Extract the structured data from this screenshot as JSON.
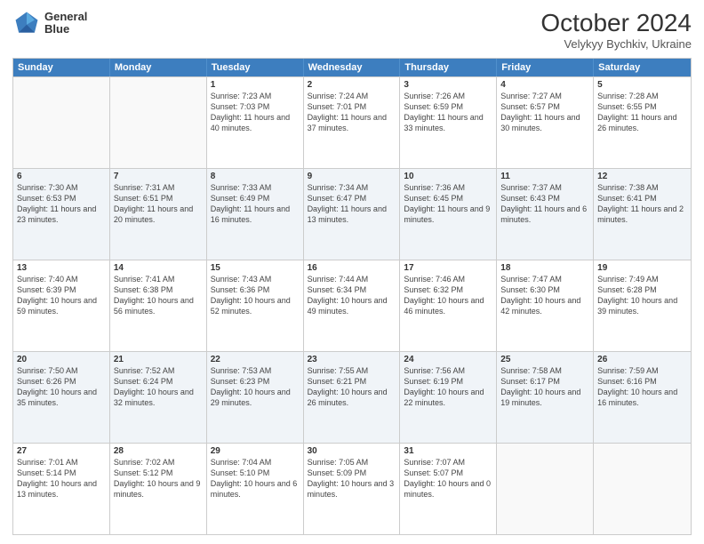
{
  "header": {
    "logo": {
      "line1": "General",
      "line2": "Blue"
    },
    "title": "October 2024",
    "location": "Velykyy Bychkiv, Ukraine"
  },
  "days_of_week": [
    "Sunday",
    "Monday",
    "Tuesday",
    "Wednesday",
    "Thursday",
    "Friday",
    "Saturday"
  ],
  "weeks": [
    [
      {
        "day": "",
        "sunrise": "",
        "sunset": "",
        "daylight": "",
        "empty": true
      },
      {
        "day": "",
        "sunrise": "",
        "sunset": "",
        "daylight": "",
        "empty": true
      },
      {
        "day": "1",
        "sunrise": "Sunrise: 7:23 AM",
        "sunset": "Sunset: 7:03 PM",
        "daylight": "Daylight: 11 hours and 40 minutes.",
        "empty": false
      },
      {
        "day": "2",
        "sunrise": "Sunrise: 7:24 AM",
        "sunset": "Sunset: 7:01 PM",
        "daylight": "Daylight: 11 hours and 37 minutes.",
        "empty": false
      },
      {
        "day": "3",
        "sunrise": "Sunrise: 7:26 AM",
        "sunset": "Sunset: 6:59 PM",
        "daylight": "Daylight: 11 hours and 33 minutes.",
        "empty": false
      },
      {
        "day": "4",
        "sunrise": "Sunrise: 7:27 AM",
        "sunset": "Sunset: 6:57 PM",
        "daylight": "Daylight: 11 hours and 30 minutes.",
        "empty": false
      },
      {
        "day": "5",
        "sunrise": "Sunrise: 7:28 AM",
        "sunset": "Sunset: 6:55 PM",
        "daylight": "Daylight: 11 hours and 26 minutes.",
        "empty": false
      }
    ],
    [
      {
        "day": "6",
        "sunrise": "Sunrise: 7:30 AM",
        "sunset": "Sunset: 6:53 PM",
        "daylight": "Daylight: 11 hours and 23 minutes.",
        "empty": false
      },
      {
        "day": "7",
        "sunrise": "Sunrise: 7:31 AM",
        "sunset": "Sunset: 6:51 PM",
        "daylight": "Daylight: 11 hours and 20 minutes.",
        "empty": false
      },
      {
        "day": "8",
        "sunrise": "Sunrise: 7:33 AM",
        "sunset": "Sunset: 6:49 PM",
        "daylight": "Daylight: 11 hours and 16 minutes.",
        "empty": false
      },
      {
        "day": "9",
        "sunrise": "Sunrise: 7:34 AM",
        "sunset": "Sunset: 6:47 PM",
        "daylight": "Daylight: 11 hours and 13 minutes.",
        "empty": false
      },
      {
        "day": "10",
        "sunrise": "Sunrise: 7:36 AM",
        "sunset": "Sunset: 6:45 PM",
        "daylight": "Daylight: 11 hours and 9 minutes.",
        "empty": false
      },
      {
        "day": "11",
        "sunrise": "Sunrise: 7:37 AM",
        "sunset": "Sunset: 6:43 PM",
        "daylight": "Daylight: 11 hours and 6 minutes.",
        "empty": false
      },
      {
        "day": "12",
        "sunrise": "Sunrise: 7:38 AM",
        "sunset": "Sunset: 6:41 PM",
        "daylight": "Daylight: 11 hours and 2 minutes.",
        "empty": false
      }
    ],
    [
      {
        "day": "13",
        "sunrise": "Sunrise: 7:40 AM",
        "sunset": "Sunset: 6:39 PM",
        "daylight": "Daylight: 10 hours and 59 minutes.",
        "empty": false
      },
      {
        "day": "14",
        "sunrise": "Sunrise: 7:41 AM",
        "sunset": "Sunset: 6:38 PM",
        "daylight": "Daylight: 10 hours and 56 minutes.",
        "empty": false
      },
      {
        "day": "15",
        "sunrise": "Sunrise: 7:43 AM",
        "sunset": "Sunset: 6:36 PM",
        "daylight": "Daylight: 10 hours and 52 minutes.",
        "empty": false
      },
      {
        "day": "16",
        "sunrise": "Sunrise: 7:44 AM",
        "sunset": "Sunset: 6:34 PM",
        "daylight": "Daylight: 10 hours and 49 minutes.",
        "empty": false
      },
      {
        "day": "17",
        "sunrise": "Sunrise: 7:46 AM",
        "sunset": "Sunset: 6:32 PM",
        "daylight": "Daylight: 10 hours and 46 minutes.",
        "empty": false
      },
      {
        "day": "18",
        "sunrise": "Sunrise: 7:47 AM",
        "sunset": "Sunset: 6:30 PM",
        "daylight": "Daylight: 10 hours and 42 minutes.",
        "empty": false
      },
      {
        "day": "19",
        "sunrise": "Sunrise: 7:49 AM",
        "sunset": "Sunset: 6:28 PM",
        "daylight": "Daylight: 10 hours and 39 minutes.",
        "empty": false
      }
    ],
    [
      {
        "day": "20",
        "sunrise": "Sunrise: 7:50 AM",
        "sunset": "Sunset: 6:26 PM",
        "daylight": "Daylight: 10 hours and 35 minutes.",
        "empty": false
      },
      {
        "day": "21",
        "sunrise": "Sunrise: 7:52 AM",
        "sunset": "Sunset: 6:24 PM",
        "daylight": "Daylight: 10 hours and 32 minutes.",
        "empty": false
      },
      {
        "day": "22",
        "sunrise": "Sunrise: 7:53 AM",
        "sunset": "Sunset: 6:23 PM",
        "daylight": "Daylight: 10 hours and 29 minutes.",
        "empty": false
      },
      {
        "day": "23",
        "sunrise": "Sunrise: 7:55 AM",
        "sunset": "Sunset: 6:21 PM",
        "daylight": "Daylight: 10 hours and 26 minutes.",
        "empty": false
      },
      {
        "day": "24",
        "sunrise": "Sunrise: 7:56 AM",
        "sunset": "Sunset: 6:19 PM",
        "daylight": "Daylight: 10 hours and 22 minutes.",
        "empty": false
      },
      {
        "day": "25",
        "sunrise": "Sunrise: 7:58 AM",
        "sunset": "Sunset: 6:17 PM",
        "daylight": "Daylight: 10 hours and 19 minutes.",
        "empty": false
      },
      {
        "day": "26",
        "sunrise": "Sunrise: 7:59 AM",
        "sunset": "Sunset: 6:16 PM",
        "daylight": "Daylight: 10 hours and 16 minutes.",
        "empty": false
      }
    ],
    [
      {
        "day": "27",
        "sunrise": "Sunrise: 7:01 AM",
        "sunset": "Sunset: 5:14 PM",
        "daylight": "Daylight: 10 hours and 13 minutes.",
        "empty": false
      },
      {
        "day": "28",
        "sunrise": "Sunrise: 7:02 AM",
        "sunset": "Sunset: 5:12 PM",
        "daylight": "Daylight: 10 hours and 9 minutes.",
        "empty": false
      },
      {
        "day": "29",
        "sunrise": "Sunrise: 7:04 AM",
        "sunset": "Sunset: 5:10 PM",
        "daylight": "Daylight: 10 hours and 6 minutes.",
        "empty": false
      },
      {
        "day": "30",
        "sunrise": "Sunrise: 7:05 AM",
        "sunset": "Sunset: 5:09 PM",
        "daylight": "Daylight: 10 hours and 3 minutes.",
        "empty": false
      },
      {
        "day": "31",
        "sunrise": "Sunrise: 7:07 AM",
        "sunset": "Sunset: 5:07 PM",
        "daylight": "Daylight: 10 hours and 0 minutes.",
        "empty": false
      },
      {
        "day": "",
        "sunrise": "",
        "sunset": "",
        "daylight": "",
        "empty": true
      },
      {
        "day": "",
        "sunrise": "",
        "sunset": "",
        "daylight": "",
        "empty": true
      }
    ]
  ]
}
